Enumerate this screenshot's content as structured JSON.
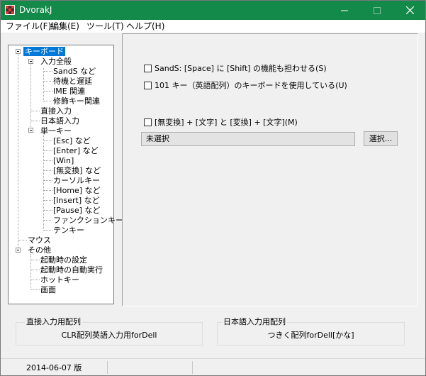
{
  "window": {
    "title": "DvorakJ"
  },
  "menu": {
    "items": [
      "ファイル(F)",
      "編集(E)",
      "ツール(T)",
      "ヘルプ(H)"
    ]
  },
  "tree": {
    "root_keyboard": "キーボード",
    "input_general": "入力全般",
    "sands": "SandS など",
    "wait_delay": "待機と遅延",
    "ime": "IME 関連",
    "modifier": "修飾キー関連",
    "direct_input": "直接入力",
    "japanese_input": "日本語入力",
    "single_key": "単一キー",
    "esc": "[Esc] など",
    "enter": "[Enter] など",
    "win": "[Win]",
    "muhenkan": "[無変換] など",
    "cursor": "カーソルキー",
    "home": "[Home] など",
    "insert": "[Insert] など",
    "pause": "[Pause] など",
    "function": "ファンクションキー",
    "tenkey": "テンキー",
    "mouse": "マウス",
    "other": "その他",
    "startup_settings": "起動時の設定",
    "startup_autorun": "起動時の自動実行",
    "hotkey": "ホットキー",
    "screen": "画面"
  },
  "panel": {
    "sands_option": "SandS: [Space] に [Shift] の機能も担わせる(S)",
    "key101_option": "101 キー（英語配列）のキーボードを使用している(U)",
    "combo_option": "[無変換] + [文字] と [変換] + [文字](M)",
    "combo_value": "未選択",
    "select_label": "選択..."
  },
  "groups": {
    "direct_label": "直接入力用配列",
    "direct_value": "CLR配列英語入力用forDell",
    "japanese_label": "日本語入力用配列",
    "japanese_value": "つきく配列forDell[かな]"
  },
  "status": {
    "version": "2014-06-07 版"
  }
}
